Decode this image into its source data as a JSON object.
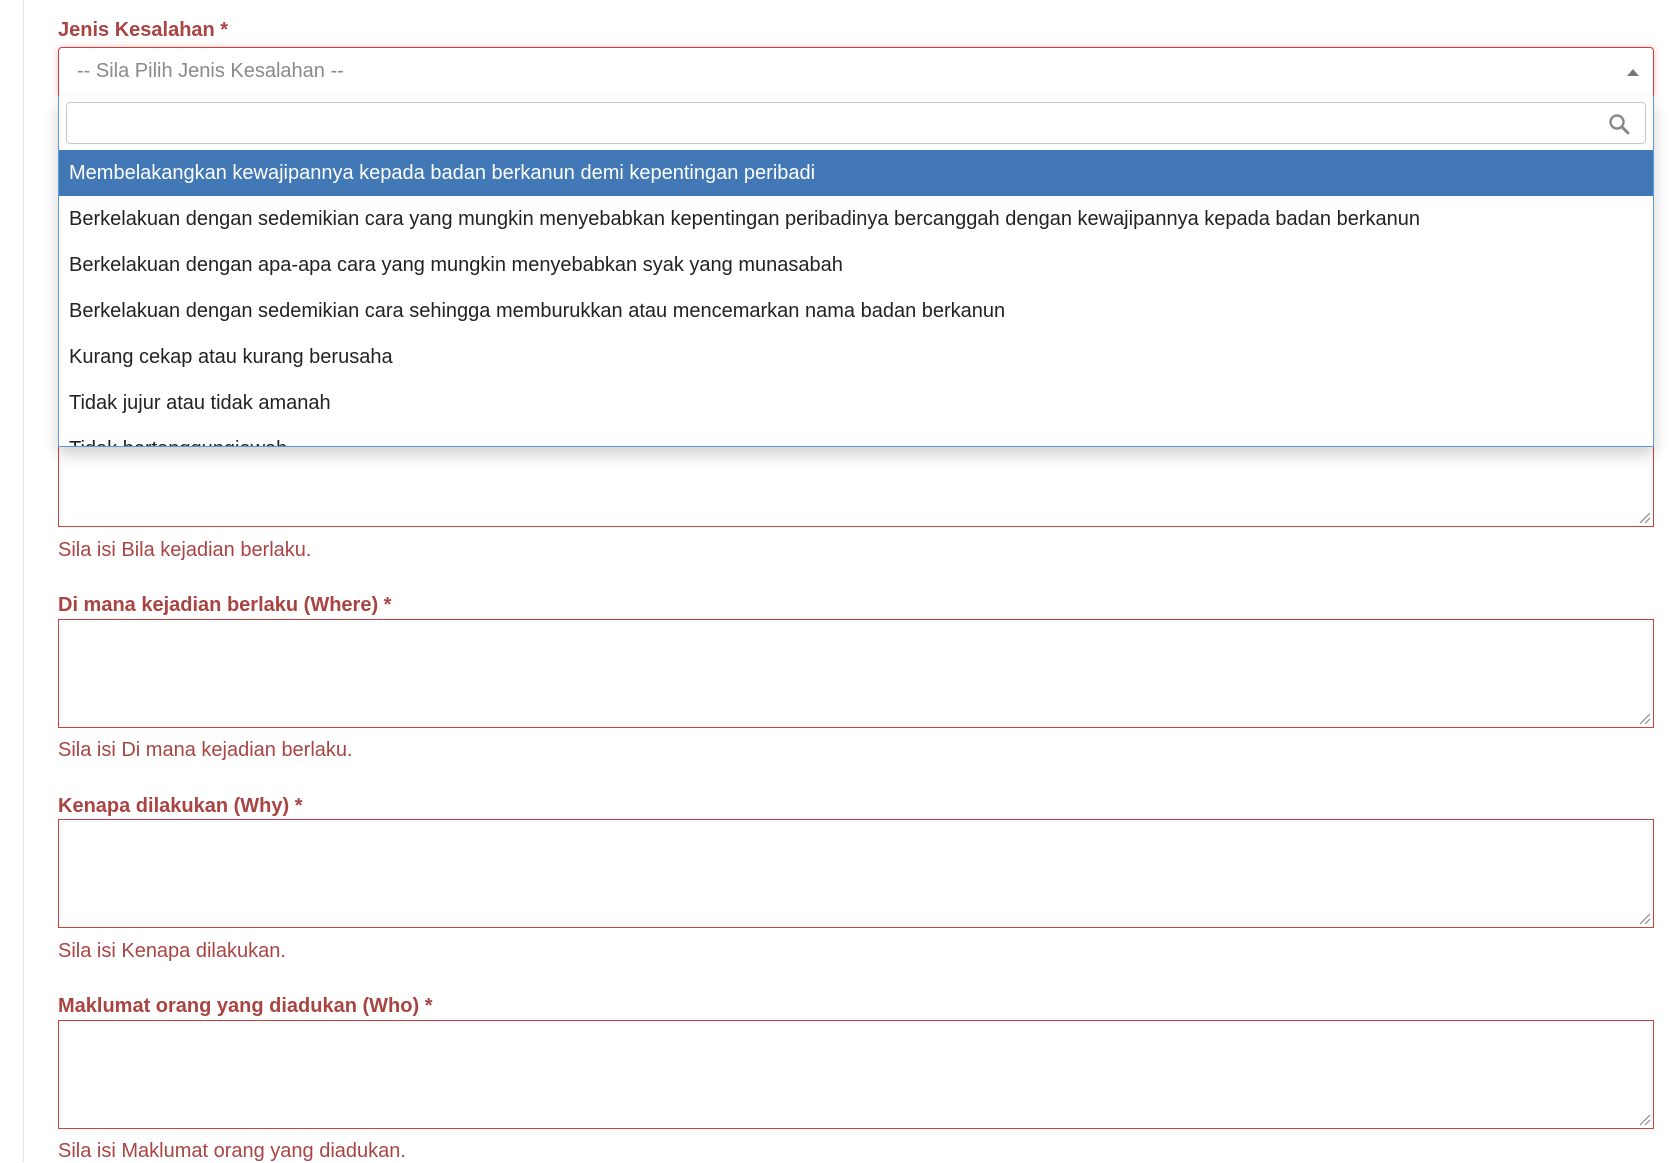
{
  "jenis_kesalahan": {
    "label": "Jenis Kesalahan *",
    "placeholder": "-- Sila Pilih Jenis Kesalahan --",
    "search_value": "",
    "options": [
      "Membelakangkan kewajipannya kepada badan berkanun demi kepentingan peribadi",
      "Berkelakuan dengan sedemikian cara yang mungkin menyebabkan kepentingan peribadinya bercanggah dengan kewajipannya kepada badan berkanun",
      "Berkelakuan dengan apa-apa cara yang mungkin menyebabkan syak yang munasabah",
      "Berkelakuan dengan sedemikian cara sehingga memburukkan atau mencemarkan nama badan berkanun",
      "Kurang cekap atau kurang berusaha",
      "Tidak jujur atau tidak amanah",
      "Tidak bertanggungjawab"
    ],
    "highlighted_index": 0,
    "highlight_color": "#4178b5",
    "icons": {
      "arrow": "caret-up-icon",
      "search": "search-icon"
    }
  },
  "bila": {
    "error": "Sila isi Bila kejadian berlaku."
  },
  "di_mana": {
    "label": "Di mana kejadian berlaku (Where) *",
    "value": "",
    "error": "Sila isi Di mana kejadian berlaku."
  },
  "kenapa": {
    "label": "Kenapa dilakukan (Why) *",
    "value": "",
    "error": "Sila isi Kenapa dilakukan."
  },
  "maklumat": {
    "label": "Maklumat orang yang diadukan (Who) *",
    "value": "",
    "error": "Sila isi Maklumat orang yang diadukan."
  },
  "colors": {
    "error": "#a94442",
    "error_border": "#c9403c",
    "focus_border": "#5c9bd6"
  }
}
